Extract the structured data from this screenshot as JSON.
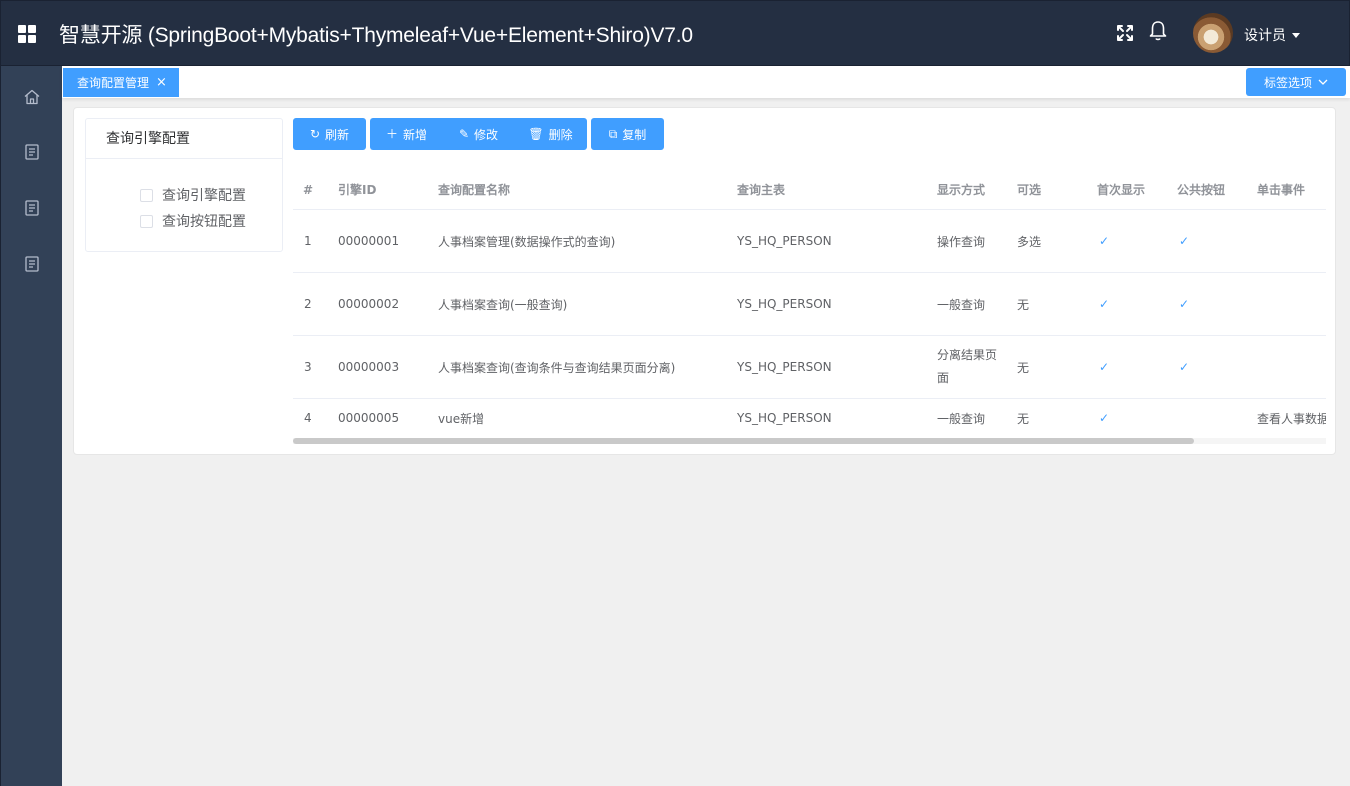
{
  "header": {
    "title": "智慧开源 (SpringBoot+Mybatis+Thymeleaf+Vue+Element+Shiro)V7.0",
    "user_name": "设计员",
    "icons": [
      "menu-grid-icon",
      "fullscreen-icon",
      "bell-icon",
      "avatar"
    ]
  },
  "sidebar": {
    "items": [
      {
        "icon": "home-icon"
      },
      {
        "icon": "document-icon"
      },
      {
        "icon": "document-icon"
      },
      {
        "icon": "document-icon"
      }
    ]
  },
  "tags": {
    "active_tag": "查询配置管理",
    "close": "×",
    "options_label": "标签选项"
  },
  "left_panel": {
    "title": "查询引擎配置",
    "items": [
      "查询引擎配置",
      "查询按钮配置"
    ]
  },
  "toolbar": {
    "refresh": "刷新",
    "add": "新增",
    "edit": "修改",
    "delete": "删除",
    "copy": "复制"
  },
  "table": {
    "columns": [
      "#",
      "引擎ID",
      "查询配置名称",
      "查询主表",
      "显示方式",
      "可选",
      "首次显示",
      "公共按钮",
      "单击事件"
    ],
    "rows": [
      {
        "index": "1",
        "id": "00000001",
        "name": "人事档案管理(数据操作式的查询)",
        "table": "YS_HQ_PERSON",
        "display": "操作查询",
        "select": "多选",
        "first_show": "✓",
        "public_btn": "✓",
        "click_event": ""
      },
      {
        "index": "2",
        "id": "00000002",
        "name": "人事档案查询(一般查询)",
        "table": "YS_HQ_PERSON",
        "display": "一般查询",
        "select": "无",
        "first_show": "✓",
        "public_btn": "✓",
        "click_event": ""
      },
      {
        "index": "3",
        "id": "00000003",
        "name": "人事档案查询(查询条件与查询结果页面分离)",
        "table": "YS_HQ_PERSON",
        "display": "分离结果页面",
        "select": "无",
        "first_show": "✓",
        "public_btn": "✓",
        "click_event": ""
      },
      {
        "index": "4",
        "id": "00000005",
        "name": "vue新增",
        "table": "YS_HQ_PERSON",
        "display": "一般查询",
        "select": "无",
        "first_show": "✓",
        "public_btn": "",
        "click_event": "查看人事数据"
      }
    ]
  },
  "colors": {
    "header_bg": "#242f42",
    "sidebar_bg": "#324157",
    "accent": "#409eff"
  }
}
